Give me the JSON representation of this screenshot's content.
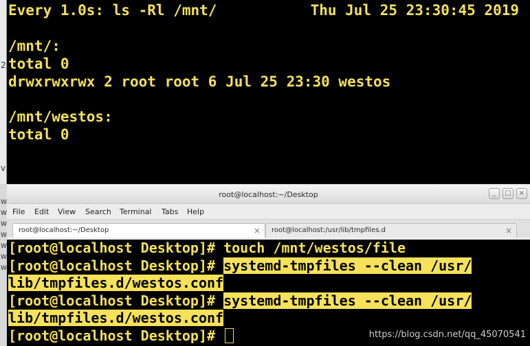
{
  "watch_terminal": {
    "header_left": "Every 1.0s: ls -Rl /mnt/",
    "header_right": "Thu Jul 25 23:30:45 2019",
    "lines": [
      "/mnt/:",
      "total 0",
      "drwxrwxrwx 2 root root 6 Jul 25 23:30 westos",
      "",
      "/mnt/westos:",
      "total 0"
    ],
    "edge_glyphs": [
      "2",
      "v"
    ]
  },
  "left_strip_glyphs": [
    "W",
    "W",
    "W",
    "W",
    "W",
    "W",
    "W"
  ],
  "window": {
    "title": "root@localhost:~/Desktop",
    "controls": [
      "_",
      "□",
      "×"
    ]
  },
  "menu": [
    "File",
    "Edit",
    "View",
    "Search",
    "Terminal",
    "Tabs",
    "Help"
  ],
  "tabs": [
    {
      "label": "root@localhost:~/Desktop",
      "active": true,
      "close": "×"
    },
    {
      "label": "root@localhost:/usr/lib/tmpfiles.d",
      "active": false,
      "close": "×"
    }
  ],
  "terminal": {
    "prompt": "[root@localhost Desktop]# ",
    "cmd1": "touch /mnt/westos/file",
    "cmd2_a": "systemd-tmpfiles --clean /usr/",
    "cmd2_b": "lib/tmpfiles.d/westos.conf",
    "cmd3_a": "systemd-tmpfiles --clean /usr/",
    "cmd3_b": "lib/tmpfiles.d/westos.conf"
  },
  "watermark": "https://blog.csdn.net/qq_45070541",
  "colors": {
    "terminal_fg": "#f5e15a",
    "terminal_bg": "#000000",
    "selection_bg": "#f5e15a"
  }
}
